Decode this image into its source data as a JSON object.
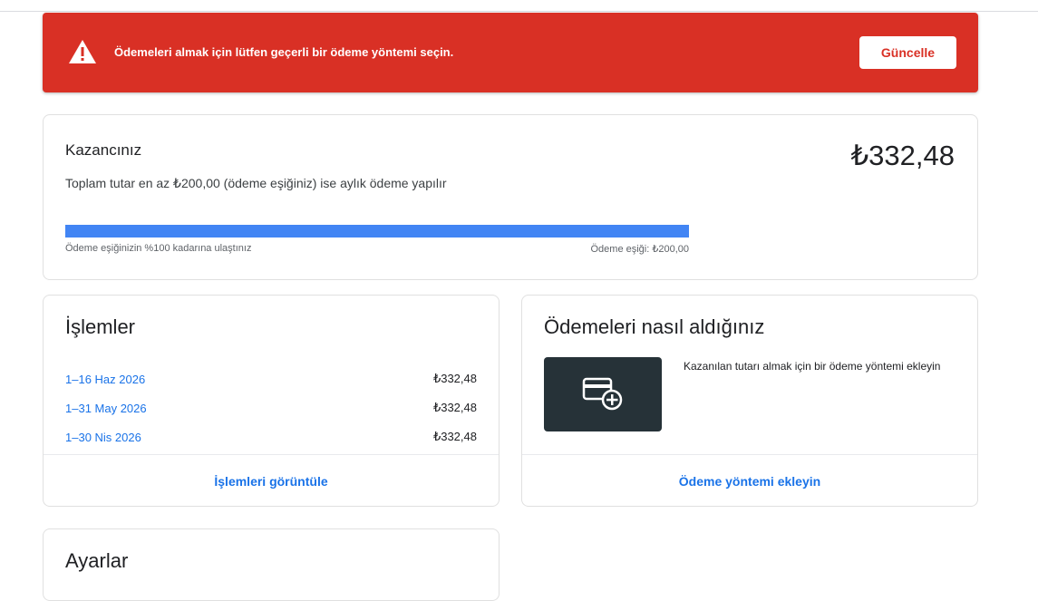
{
  "alert": {
    "icon": "warning-icon",
    "message": "Ödemeleri almak için lütfen geçerli bir ödeme yöntemi seçin.",
    "button_label": "Güncelle",
    "color": "#d93025"
  },
  "earnings": {
    "title": "Kazancınız",
    "amount": "₺332,48",
    "subtitle": "Toplam tutar en az ₺200,00 (ödeme eşiğiniz) ise aylık ödeme yapılır",
    "progress_percent": 100,
    "progress_left_label": "Ödeme eşiğinizin %100 kadarına ulaştınız",
    "progress_right_label": "Ödeme eşiği: ₺200,00",
    "progress_color": "#4285f4"
  },
  "transactions": {
    "title": "İşlemler",
    "rows": [
      {
        "date": "1–16 Haz 2026",
        "value": "₺332,48"
      },
      {
        "date": "1–31 May 2026",
        "value": "₺332,48"
      },
      {
        "date": "1–30 Nis 2026",
        "value": "₺332,48"
      }
    ],
    "link_label": "İşlemleri görüntüle"
  },
  "payments": {
    "title": "Ödemeleri nasıl aldığınız",
    "icon": "add-card-icon",
    "description": "Kazanılan tutarı almak için bir ödeme yöntemi ekleyin",
    "link_label": "Ödeme yöntemi ekleyin"
  },
  "settings": {
    "title": "Ayarlar"
  }
}
